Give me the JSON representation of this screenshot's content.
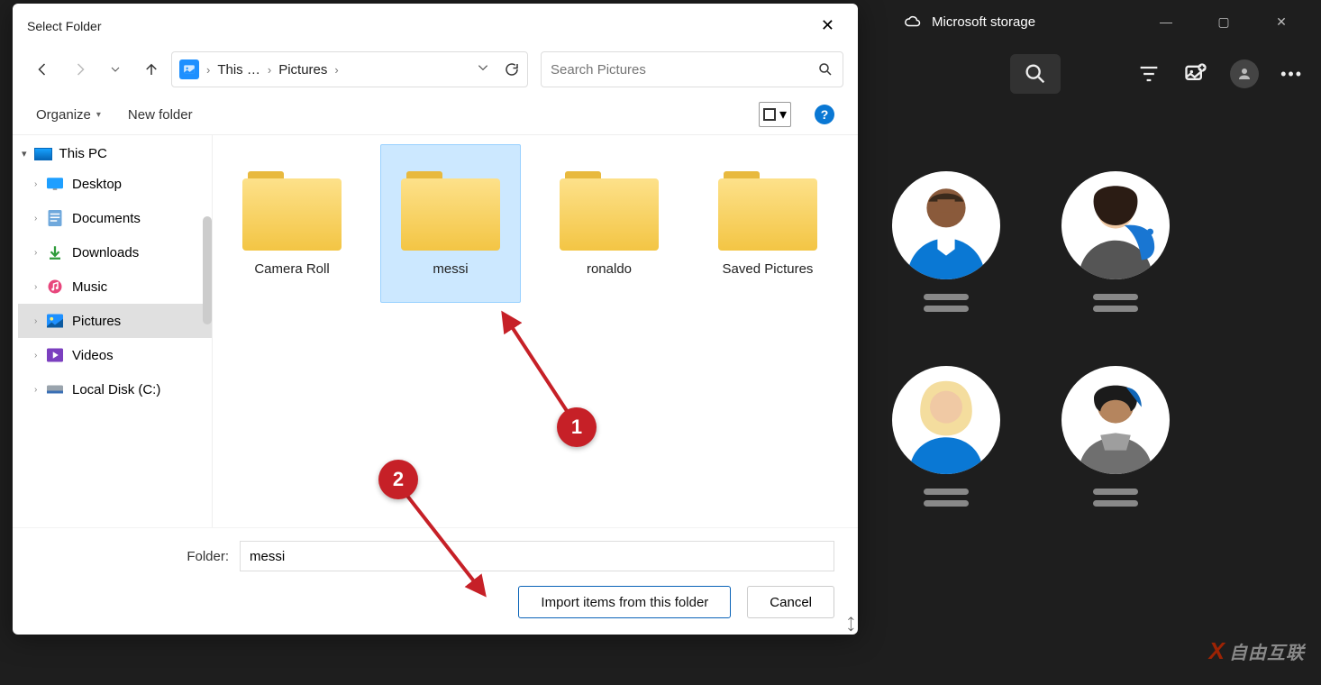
{
  "photos": {
    "title": "Microsoft storage",
    "winctl": {
      "min": "—",
      "max": "▢",
      "close": "✕"
    }
  },
  "dialog": {
    "title": "Select Folder",
    "breadcrumb": {
      "root": "This …",
      "leaf": "Pictures"
    },
    "search_placeholder": "Search Pictures",
    "toolbar": {
      "organize": "Organize",
      "newfolder": "New folder"
    },
    "sidebar": {
      "root": "This PC",
      "items": [
        {
          "label": "Desktop"
        },
        {
          "label": "Documents"
        },
        {
          "label": "Downloads"
        },
        {
          "label": "Music"
        },
        {
          "label": "Pictures"
        },
        {
          "label": "Videos"
        },
        {
          "label": "Local Disk (C:)"
        }
      ]
    },
    "folders": [
      {
        "label": "Camera Roll"
      },
      {
        "label": "messi"
      },
      {
        "label": "ronaldo"
      },
      {
        "label": "Saved Pictures"
      }
    ],
    "footer": {
      "folder_label": "Folder:",
      "folder_value": "messi",
      "import_btn": "Import items from this folder",
      "cancel_btn": "Cancel"
    }
  },
  "annotations": {
    "one": "1",
    "two": "2"
  },
  "watermark": "自由互联"
}
